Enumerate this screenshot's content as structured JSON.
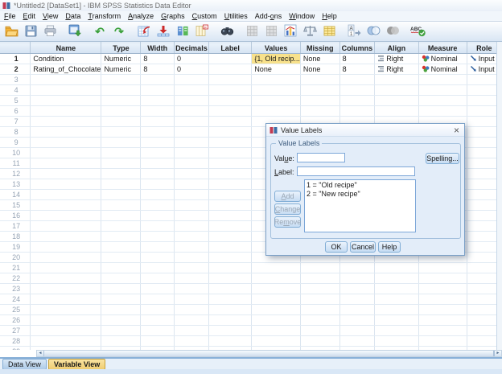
{
  "window": {
    "title": "*Untitled2 [DataSet1] - IBM SPSS Statistics Data Editor"
  },
  "menus": [
    {
      "label": "File",
      "accel": 0
    },
    {
      "label": "Edit",
      "accel": 0
    },
    {
      "label": "View",
      "accel": 0
    },
    {
      "label": "Data",
      "accel": 0
    },
    {
      "label": "Transform",
      "accel": 0
    },
    {
      "label": "Analyze",
      "accel": 0
    },
    {
      "label": "Graphs",
      "accel": 0
    },
    {
      "label": "Custom",
      "accel": 0
    },
    {
      "label": "Utilities",
      "accel": 0
    },
    {
      "label": "Add-ons",
      "accel": 4
    },
    {
      "label": "Window",
      "accel": 0
    },
    {
      "label": "Help",
      "accel": 0
    }
  ],
  "toolbar": {
    "buttons": [
      {
        "name": "open-data",
        "disabled": false
      },
      {
        "name": "save",
        "disabled": false
      },
      {
        "name": "print",
        "disabled": false
      },
      {
        "name": "recall-dialogs",
        "disabled": false,
        "gap": true
      },
      {
        "name": "undo",
        "disabled": false,
        "gap": true
      },
      {
        "name": "redo",
        "disabled": false
      },
      {
        "name": "goto-case",
        "disabled": false,
        "gap": true
      },
      {
        "name": "goto-variable",
        "disabled": false
      },
      {
        "name": "variables",
        "disabled": false
      },
      {
        "name": "descriptives",
        "disabled": false
      },
      {
        "name": "find",
        "disabled": false,
        "gap": true
      },
      {
        "name": "insert-cases",
        "disabled": true,
        "gap": true
      },
      {
        "name": "insert-variable",
        "disabled": true
      },
      {
        "name": "split-file",
        "disabled": false
      },
      {
        "name": "weight-cases",
        "disabled": false
      },
      {
        "name": "select-cases",
        "disabled": false
      },
      {
        "name": "value-labels",
        "disabled": false,
        "gap": true
      },
      {
        "name": "use-variable-sets",
        "disabled": false
      },
      {
        "name": "show-all-variables",
        "disabled": false
      },
      {
        "name": "spell-check",
        "disabled": false,
        "gap": true
      }
    ]
  },
  "grid": {
    "headers": [
      "Name",
      "Type",
      "Width",
      "Decimals",
      "Label",
      "Values",
      "Missing",
      "Columns",
      "Align",
      "Measure",
      "Role"
    ],
    "rows": [
      {
        "num": "1",
        "name": "Condition",
        "type": "Numeric",
        "width": "8",
        "decimals": "0",
        "label": "",
        "values": "{1, Old recip...",
        "values_selected": true,
        "missing": "None",
        "columns": "8",
        "align": "Right",
        "measure": "Nominal",
        "role": "Input"
      },
      {
        "num": "2",
        "name": "Rating_of_Chocolate",
        "type": "Numeric",
        "width": "8",
        "decimals": "0",
        "label": "",
        "values": "None",
        "values_selected": false,
        "missing": "None",
        "columns": "8",
        "align": "Right",
        "measure": "Nominal",
        "role": "Input"
      }
    ],
    "empty_rows_from": 3,
    "empty_rows_to": 29
  },
  "dialog": {
    "title": "Value Labels",
    "group_title": "Value Labels",
    "value_field": {
      "label": "Value:",
      "accel": 3,
      "value": ""
    },
    "label_field": {
      "label": "Label:",
      "accel": 0,
      "value": ""
    },
    "spelling_button": "Spelling...",
    "buttons": {
      "add": {
        "label": "Add",
        "accel": 0
      },
      "change": {
        "label": "Change",
        "accel": 0
      },
      "remove": {
        "label": "Remove",
        "accel": 2
      },
      "ok": "OK",
      "cancel": "Cancel",
      "help": "Help"
    },
    "list_items": [
      "1 = \"Old recipe\"",
      "2 = \"New recipe\""
    ],
    "close_glyph": "×"
  },
  "tabs": [
    {
      "label": "Data View",
      "active": false
    },
    {
      "label": "Variable View",
      "active": true
    }
  ],
  "colors": {
    "selected_value_cell": "#f8e18b",
    "active_tab": "#f0cd72",
    "header_fill": "#d5e3f2",
    "dialog_bg": "#e3edf9",
    "accent_blue": "#7da7d8"
  }
}
